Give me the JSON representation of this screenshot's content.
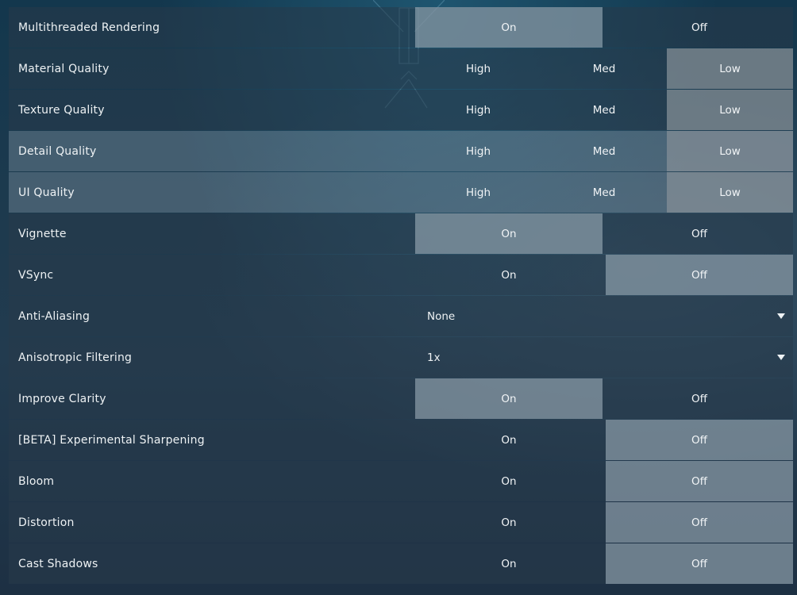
{
  "settings": [
    {
      "label": "Multithreaded Rendering",
      "type": "toggle2",
      "options": [
        "On",
        "Off"
      ],
      "selected": 0
    },
    {
      "label": "Material Quality",
      "type": "toggle3",
      "options": [
        "High",
        "Med",
        "Low"
      ],
      "selected": 2
    },
    {
      "label": "Texture Quality",
      "type": "toggle3",
      "options": [
        "High",
        "Med",
        "Low"
      ],
      "selected": 2
    },
    {
      "label": "Detail Quality",
      "type": "toggle3",
      "options": [
        "High",
        "Med",
        "Low"
      ],
      "selected": 2
    },
    {
      "label": "UI Quality",
      "type": "toggle3",
      "options": [
        "High",
        "Med",
        "Low"
      ],
      "selected": 2
    },
    {
      "label": "Vignette",
      "type": "toggle2",
      "options": [
        "On",
        "Off"
      ],
      "selected": 0
    },
    {
      "label": "VSync",
      "type": "toggle2",
      "options": [
        "On",
        "Off"
      ],
      "selected": 1
    },
    {
      "label": "Anti-Aliasing",
      "type": "dropdown",
      "value": "None"
    },
    {
      "label": "Anisotropic Filtering",
      "type": "dropdown",
      "value": "1x"
    },
    {
      "label": "Improve Clarity",
      "type": "toggle2",
      "options": [
        "On",
        "Off"
      ],
      "selected": 0
    },
    {
      "label": "[BETA] Experimental Sharpening",
      "type": "toggle2",
      "options": [
        "On",
        "Off"
      ],
      "selected": 1
    },
    {
      "label": "Bloom",
      "type": "toggle2",
      "options": [
        "On",
        "Off"
      ],
      "selected": 1
    },
    {
      "label": "Distortion",
      "type": "toggle2",
      "options": [
        "On",
        "Off"
      ],
      "selected": 1
    },
    {
      "label": "Cast Shadows",
      "type": "toggle2",
      "options": [
        "On",
        "Off"
      ],
      "selected": 1
    }
  ],
  "hovered_rows": [
    3,
    4
  ],
  "icons": {
    "dropdown": "caret-down-icon"
  }
}
